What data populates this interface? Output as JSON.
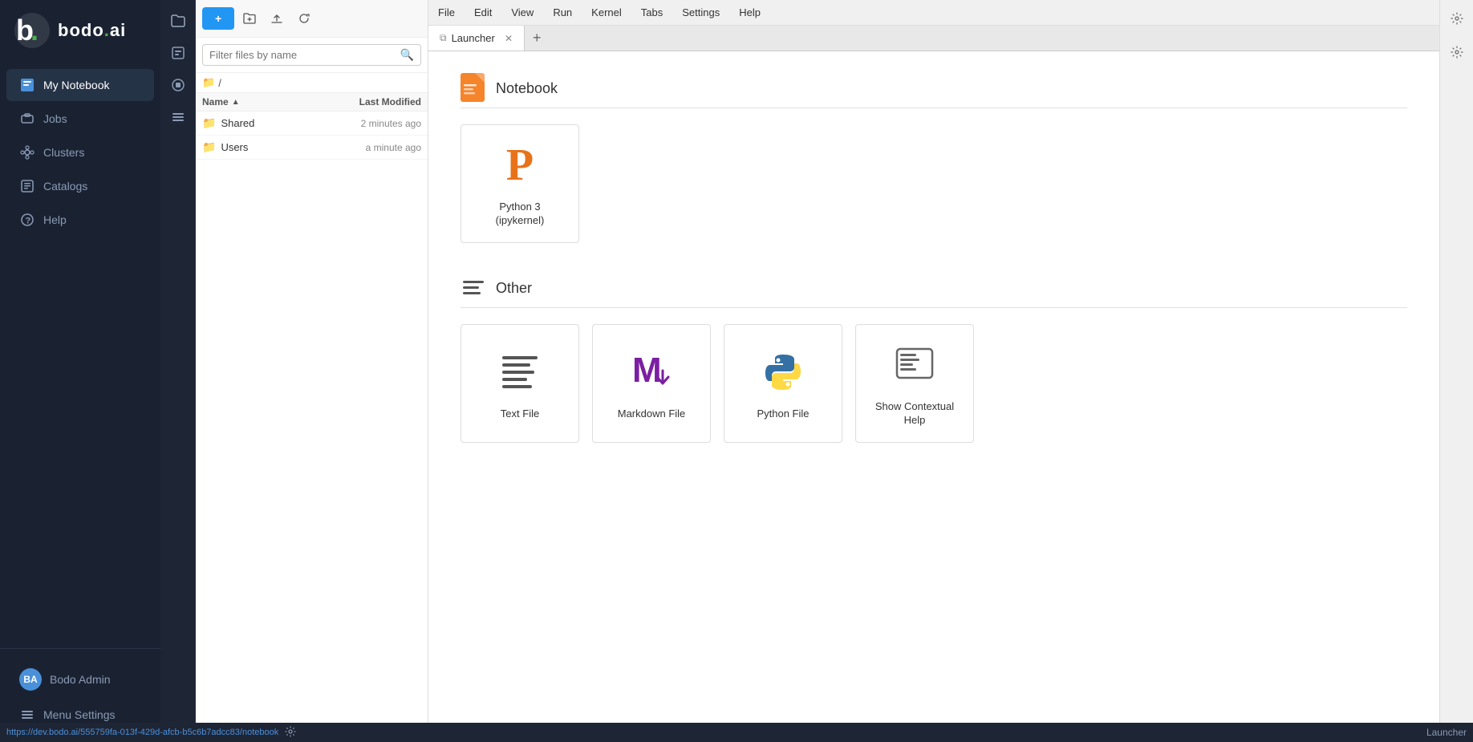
{
  "sidebar": {
    "logo_alt": "Bodo.ai",
    "nav_items": [
      {
        "id": "notebook",
        "label": "My Notebook",
        "icon": "notebook-icon",
        "active": true
      },
      {
        "id": "jobs",
        "label": "Jobs",
        "icon": "jobs-icon",
        "active": false
      },
      {
        "id": "clusters",
        "label": "Clusters",
        "icon": "clusters-icon",
        "active": false
      },
      {
        "id": "catalogs",
        "label": "Catalogs",
        "icon": "catalogs-icon",
        "active": false
      },
      {
        "id": "help",
        "label": "Help",
        "icon": "help-icon",
        "active": false
      }
    ],
    "user": "Bodo Admin",
    "menu_settings": "Menu Settings"
  },
  "file_browser": {
    "new_button": "+ ",
    "search_placeholder": "Filter files by name",
    "breadcrumb": "/",
    "columns": {
      "name": "Name",
      "modified": "Last Modified"
    },
    "files": [
      {
        "name": "Shared",
        "type": "folder",
        "modified": "2 minutes ago"
      },
      {
        "name": "Users",
        "type": "folder",
        "modified": "a minute ago"
      }
    ]
  },
  "menu_bar": {
    "items": [
      "File",
      "Edit",
      "View",
      "Run",
      "Kernel",
      "Tabs",
      "Settings",
      "Help"
    ]
  },
  "tabs": [
    {
      "id": "launcher",
      "label": "Launcher",
      "icon": "⧉",
      "active": true
    }
  ],
  "tab_add_btn": "+",
  "launcher": {
    "notebook_section": {
      "title": "Notebook",
      "cards": [
        {
          "id": "python3",
          "label": "Python 3\n(ipykernel)"
        }
      ]
    },
    "other_section": {
      "title": "Other",
      "cards": [
        {
          "id": "text-file",
          "label": "Text File"
        },
        {
          "id": "markdown-file",
          "label": "Markdown File"
        },
        {
          "id": "python-file",
          "label": "Python File"
        },
        {
          "id": "contextual-help",
          "label": "Show Contextual Help"
        }
      ]
    }
  },
  "status_bar": {
    "url": "https://dev.bodo.ai/555759fa-013f-429d-afcb-b5c6b7adcc83/notebook",
    "right": "Launcher"
  },
  "colors": {
    "accent_blue": "#2196f3",
    "bodo_orange": "#f5842a",
    "sidebar_bg": "#1a2232",
    "active_nav": "#253347"
  }
}
